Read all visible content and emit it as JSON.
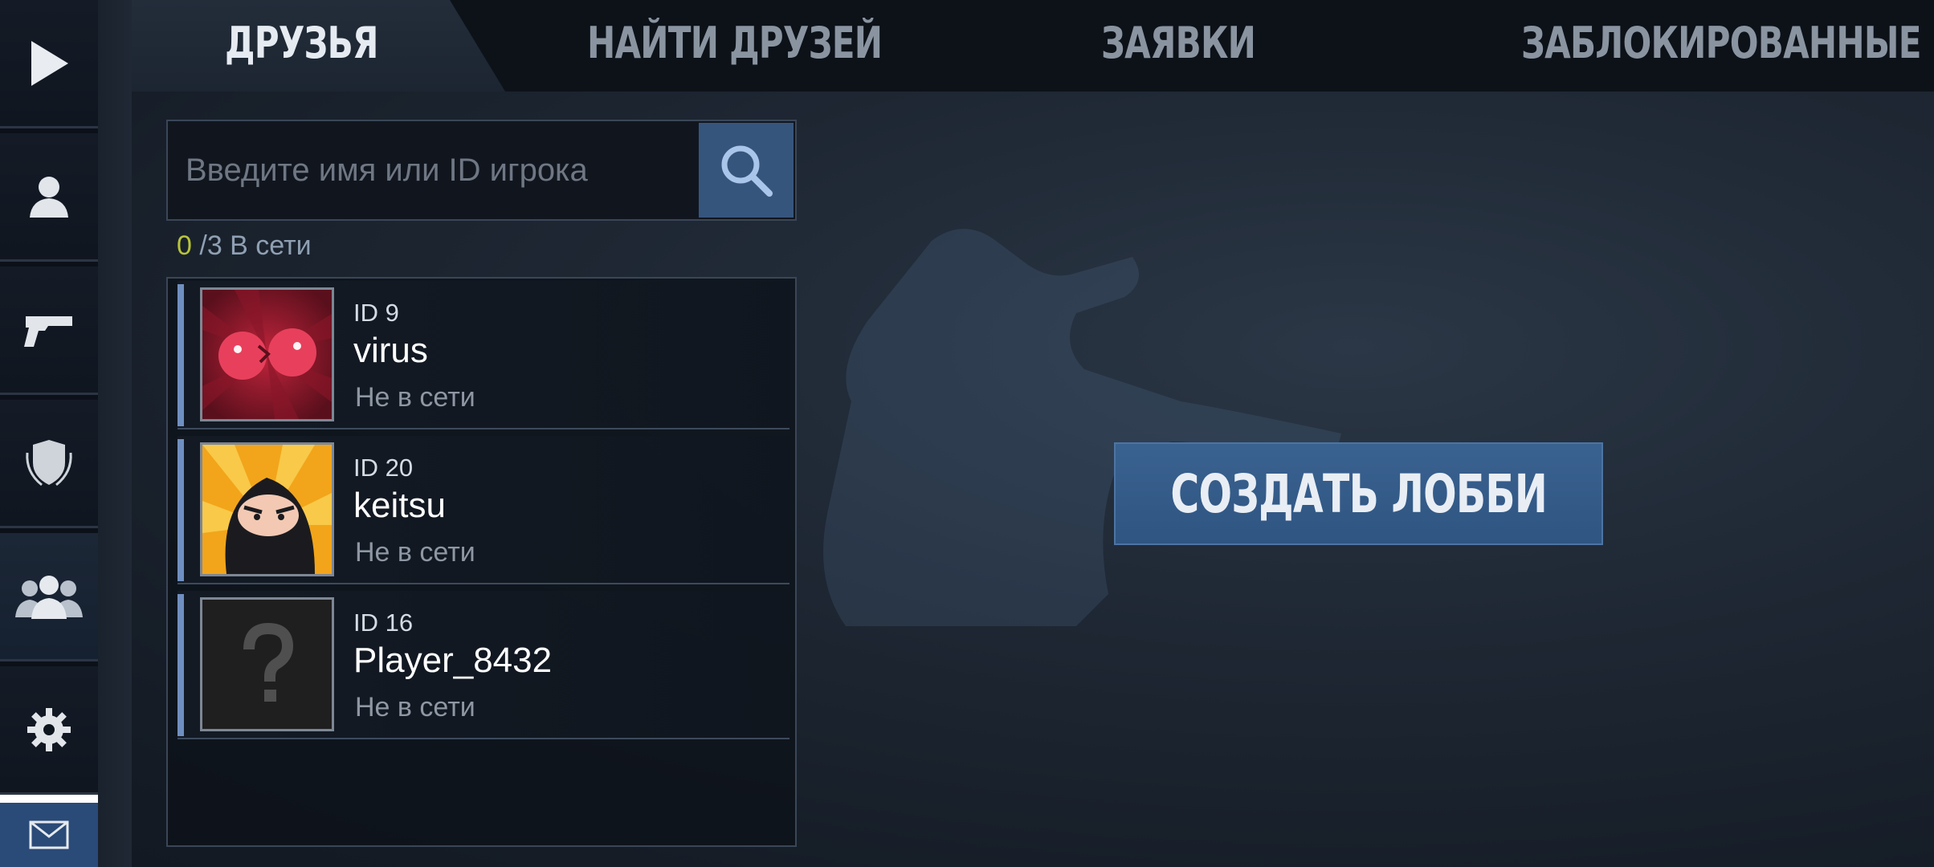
{
  "tabs": [
    {
      "label": "ДРУЗЬЯ",
      "active": true
    },
    {
      "label": "НАЙТИ ДРУЗЕЙ",
      "active": false
    },
    {
      "label": "ЗАЯВКИ",
      "active": false
    },
    {
      "label": "ЗАБЛОКИРОВАННЫЕ",
      "active": false
    }
  ],
  "sidebar": {
    "items": [
      {
        "icon": "play-icon"
      },
      {
        "icon": "profile-icon"
      },
      {
        "icon": "pistol-icon"
      },
      {
        "icon": "shield-icon"
      },
      {
        "icon": "friends-icon",
        "active": true
      },
      {
        "icon": "gear-icon"
      },
      {
        "icon": "mail-icon"
      }
    ]
  },
  "search": {
    "placeholder": "Введите имя или ID игрока",
    "value": ""
  },
  "online": {
    "count": "0",
    "separator": "/",
    "total_label": "3 В сети"
  },
  "friends": [
    {
      "id": "ID 9",
      "name": "virus",
      "status": "Не в сети",
      "avatar": "virus-avatar"
    },
    {
      "id": "ID 20",
      "name": "keitsu",
      "status": "Не в сети",
      "avatar": "ninja-avatar"
    },
    {
      "id": "ID 16",
      "name": "Player_8432",
      "status": "Не в сети",
      "avatar": "unknown-avatar"
    }
  ],
  "lobby": {
    "button_label": "СОЗДАТЬ ЛОББИ"
  },
  "colors": {
    "accent": "#36557d",
    "online_count": "#b9c43a",
    "row_accent": "#6f8fc0"
  }
}
